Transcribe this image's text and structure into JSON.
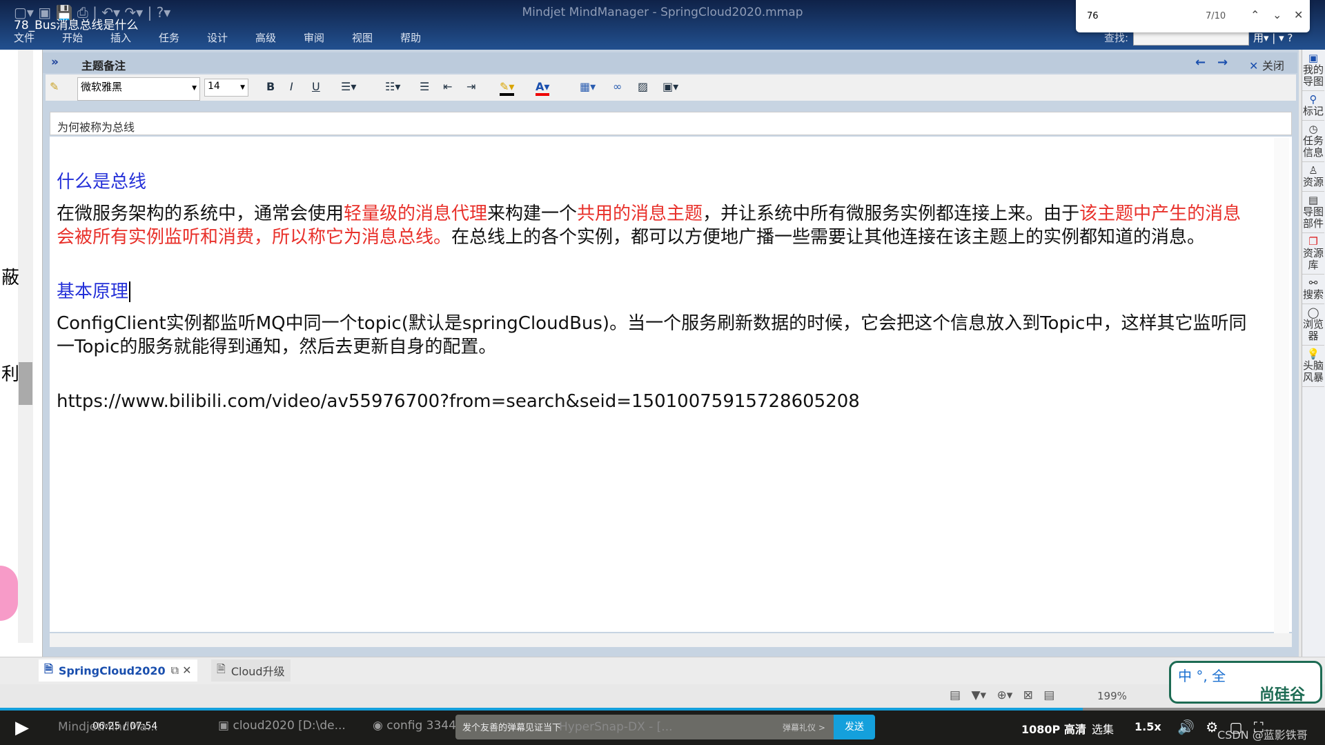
{
  "window": {
    "doc_title": "78_Bus消息总线是什么",
    "app_title": "Mindjet MindManager - SpringCloud2020.mmap"
  },
  "menu": [
    "文件",
    "开始",
    "插入",
    "任务",
    "设计",
    "高级",
    "审阅",
    "视图",
    "帮助"
  ],
  "find": {
    "query": "76",
    "count": "7/10"
  },
  "search": {
    "label": "查找:"
  },
  "panel": {
    "title": "主题备注",
    "close": "关闭"
  },
  "toolbar": {
    "font": "微软雅黑",
    "size": "14",
    "bold": "B",
    "italic": "I",
    "underline": "U"
  },
  "note": {
    "topic": "为何被称为总线",
    "h1": "什么是总线",
    "p1": [
      {
        "t": "在微服务架构的系统中，通常会使用",
        "c": ""
      },
      {
        "t": "轻量级的消息代理",
        "c": "r"
      },
      {
        "t": "来构建一个",
        "c": ""
      },
      {
        "t": "共用的消息主题",
        "c": "r"
      },
      {
        "t": "，并让系统中所有微服务实例都连接上来。由于",
        "c": ""
      },
      {
        "t": "该主题中产生的消息会被所有实例监听和消费，所以称它为消息总线。",
        "c": "r"
      },
      {
        "t": "在总线上的各个实例，都可以方便地广播一些需要让其他连接在该主题上的实例都知道的消息。",
        "c": ""
      }
    ],
    "h2": "基本原理",
    "p2": "ConfigClient实例都监听MQ中同一个topic(默认是springCloudBus)。当一个服务刷新数据的时候，它会把这个信息放入到Topic中，这样其它监听同一Topic的服务就能得到通知，然后去更新自身的配置。",
    "url": "https://www.bilibili.com/video/av55976700?from=search&seid=15010075915728605208"
  },
  "tabs": [
    {
      "label": "SpringCloud2020",
      "active": true
    },
    {
      "label": "Cloud升级",
      "active": false
    }
  ],
  "status": {
    "zoom": "199%"
  },
  "sidebar": [
    "我的导图",
    "标记",
    "任务信息",
    "资源",
    "导图部件",
    "资源库",
    "搜索",
    "浏览器",
    "头脑风暴"
  ],
  "logo": {
    "text": "尚硅谷",
    "ime": "中 °, 全"
  },
  "player": {
    "time": "06:25 / 07:54",
    "danmaku_hint": "发个友善的弹幕见证当下",
    "danmaku_gift": "弹幕礼仪 >",
    "send": "发送",
    "quality": "1080P 高清",
    "episodes": "选集",
    "speed": "1.5x",
    "progress": 0.817,
    "watermark": "CSDN @蓝影铁哥"
  },
  "taskbar": [
    "MindjetMindMa...",
    "cloud2020 [D:\\de...",
    "config 3344",
    "HyperSnap-DX - [..."
  ],
  "colors": {
    "heading": "#2430d8",
    "highlight": "#e8302a",
    "accent": "#14a0dc"
  }
}
